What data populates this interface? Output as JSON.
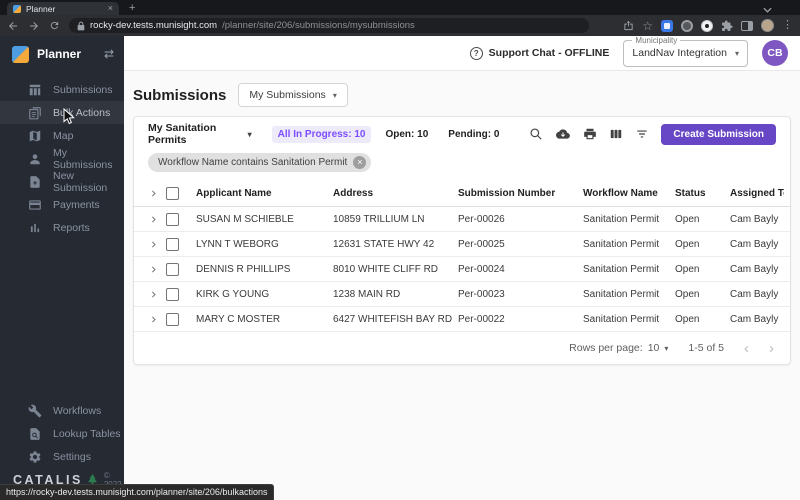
{
  "browser": {
    "tab_title": "Planner",
    "new_tab_button": "+",
    "url_host": "rocky-dev.tests.munisight.com",
    "url_path": "/planner/site/206/submissions/mysubmissions",
    "status_link": "https://rocky-dev.tests.munisight.com/planner/site/206/bulkactions"
  },
  "sidebar": {
    "app_name": "Planner",
    "items": [
      "Submissions",
      "Bulk Actions",
      "Map",
      "My Submissions",
      "New Submission",
      "Payments",
      "Reports"
    ],
    "bottom_items": [
      "Workflows",
      "Lookup Tables",
      "Settings"
    ],
    "brand": "CATALIS",
    "copyright": "© 2022"
  },
  "header": {
    "support_chat": "Support Chat - OFFLINE",
    "municipality_label": "Municipality",
    "municipality_value": "LandNav Integration",
    "avatar_initials": "CB"
  },
  "page": {
    "title": "Submissions",
    "view_selector": "My Submissions"
  },
  "toolbar": {
    "filter_dropdown": "My Sanitation Permits",
    "tabs": [
      "All In Progress: 10",
      "Open: 10",
      "Pending: 0"
    ],
    "create_button": "Create Submission"
  },
  "filter_chip": "Workflow Name contains Sanitation Permit",
  "table": {
    "columns": [
      "Applicant Name",
      "Address",
      "Submission Number",
      "Workflow Name",
      "Status",
      "Assigned To"
    ],
    "rows": [
      {
        "applicant": "SUSAN M SCHIEBLE",
        "address": "10859 TRILLIUM LN",
        "number": "Per-00026",
        "workflow": "Sanitation Permit",
        "status": "Open",
        "assigned": "Cam Bayly"
      },
      {
        "applicant": "LYNN T WEBORG",
        "address": "12631 STATE HWY 42",
        "number": "Per-00025",
        "workflow": "Sanitation Permit",
        "status": "Open",
        "assigned": "Cam Bayly"
      },
      {
        "applicant": "DENNIS R PHILLIPS",
        "address": "8010 WHITE CLIFF RD",
        "number": "Per-00024",
        "workflow": "Sanitation Permit",
        "status": "Open",
        "assigned": "Cam Bayly"
      },
      {
        "applicant": "KIRK G YOUNG",
        "address": "1238 MAIN RD",
        "number": "Per-00023",
        "workflow": "Sanitation Permit",
        "status": "Open",
        "assigned": "Cam Bayly"
      },
      {
        "applicant": "MARY C MOSTER",
        "address": "6427 WHITEFISH BAY RD",
        "number": "Per-00022",
        "workflow": "Sanitation Permit",
        "status": "Open",
        "assigned": "Cam Bayly"
      }
    ]
  },
  "pagination": {
    "rows_per_page_label": "Rows per page:",
    "rows_per_page_value": "10",
    "range": "1-5 of 5"
  },
  "colors": {
    "accent_purple": "#6747c5",
    "avatar_purple": "#7e57c2",
    "tab_active_purple": "#7c4dff",
    "sidebar_bg": "#252a33"
  }
}
